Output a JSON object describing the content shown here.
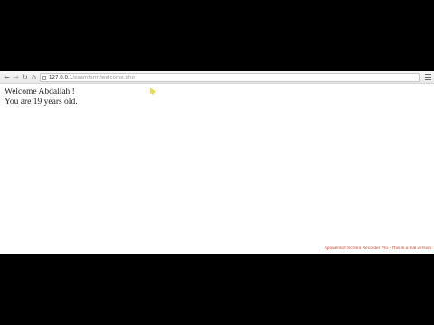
{
  "browser": {
    "address_host": "127.0.0.1",
    "address_path": "/examform/welcome.php"
  },
  "page": {
    "line1": "Welcome Abdallah !",
    "line2": "You are 19 years old."
  },
  "watermark": "Apowersoft Screen Recorder Pro - This is a trial version",
  "icons": [
    "back-icon",
    "forward-icon",
    "reload-icon",
    "home-icon",
    "page-icon",
    "menu-icon",
    "mouse-cursor-icon"
  ]
}
